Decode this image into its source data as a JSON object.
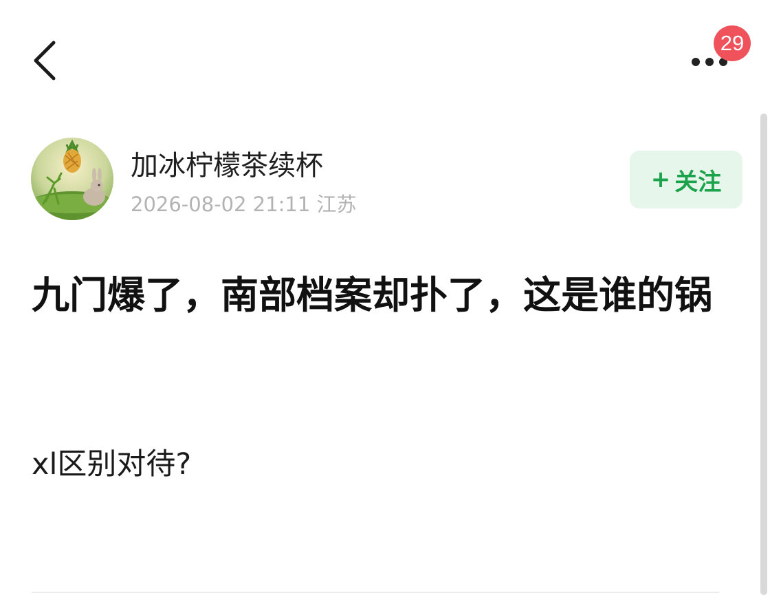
{
  "header": {
    "back_icon": "chevron-left-icon",
    "more_icon": "more-horizontal-icon",
    "notification_count": "29"
  },
  "author": {
    "name": "加冰柠檬茶续杯",
    "date": "2026-08-02 21:11",
    "location": "江苏",
    "avatar_icon": "avatar-illustration"
  },
  "follow": {
    "plus": "+",
    "label": "关注"
  },
  "post": {
    "title": "九门爆了，南部档案却扑了，这是谁的锅",
    "body": "xl区别对待?"
  },
  "colors": {
    "badge": "#f0525c",
    "follow_text": "#1aa34a",
    "follow_bg": "#e7f6ea",
    "meta_text": "#b3b3b3"
  }
}
